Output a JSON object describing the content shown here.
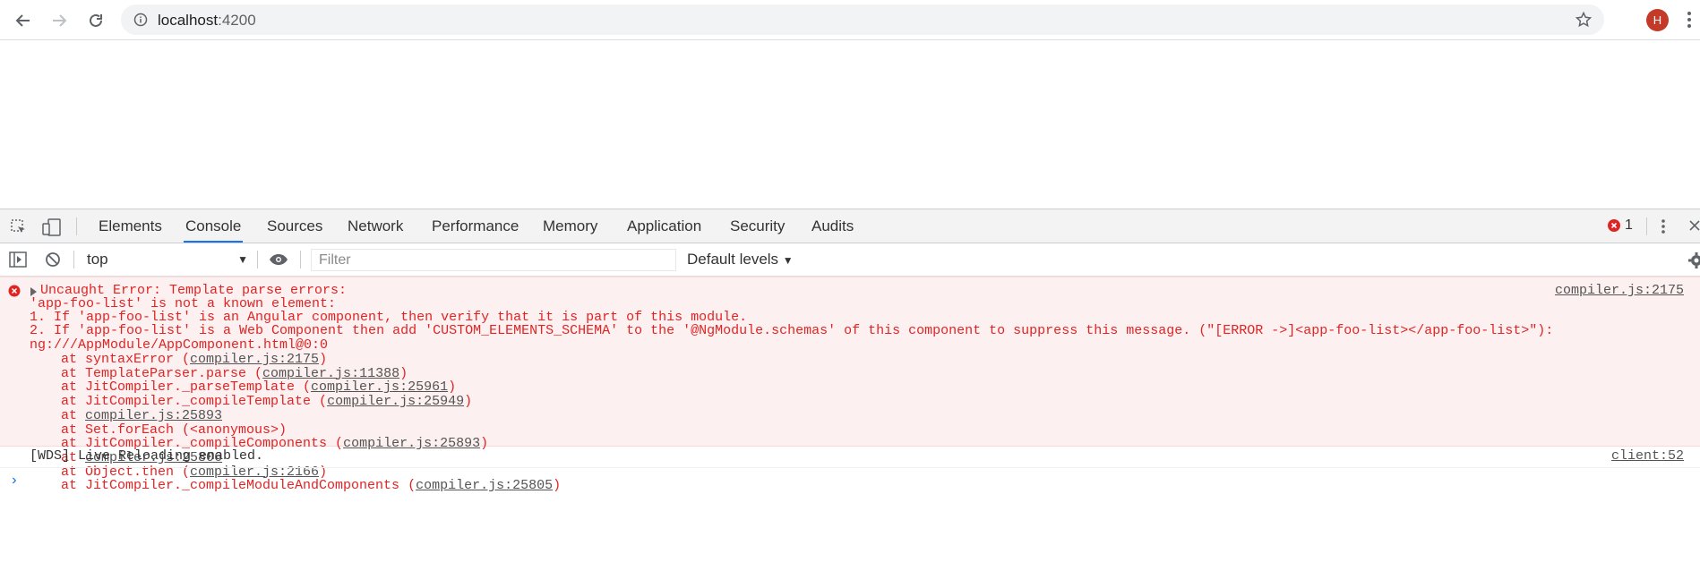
{
  "browser": {
    "url_host": "localhost",
    "url_port": ":4200",
    "avatar_letter": "H"
  },
  "devtools": {
    "tabs": [
      "Elements",
      "Console",
      "Sources",
      "Network",
      "Performance",
      "Memory",
      "Application",
      "Security",
      "Audits"
    ],
    "active_tab": "Console",
    "error_count": "1",
    "context": "top",
    "filter_placeholder": "Filter",
    "levels_label": "Default levels"
  },
  "console": {
    "error": {
      "source": "compiler.js:2175",
      "lines": [
        "Uncaught Error: Template parse errors:",
        "'app-foo-list' is not a known element:",
        "1. If 'app-foo-list' is an Angular component, then verify that it is part of this module.",
        "2. If 'app-foo-list' is a Web Component then add 'CUSTOM_ELEMENTS_SCHEMA' to the '@NgModule.schemas' of this component to suppress this message. (\"[ERROR ->]<app-foo-list></app-foo-list>\"):",
        "ng:///AppModule/AppComponent.html@0:0"
      ],
      "stack": [
        {
          "prefix": "at syntaxError (",
          "link": "compiler.js:2175",
          "suffix": ")"
        },
        {
          "prefix": "at TemplateParser.parse (",
          "link": "compiler.js:11388",
          "suffix": ")"
        },
        {
          "prefix": "at JitCompiler._parseTemplate (",
          "link": "compiler.js:25961",
          "suffix": ")"
        },
        {
          "prefix": "at JitCompiler._compileTemplate (",
          "link": "compiler.js:25949",
          "suffix": ")"
        },
        {
          "prefix": "at ",
          "link": "compiler.js:25893",
          "suffix": ""
        },
        {
          "prefix": "at Set.forEach (<anonymous>)",
          "link": "",
          "suffix": ""
        },
        {
          "prefix": "at JitCompiler._compileComponents (",
          "link": "compiler.js:25893",
          "suffix": ")"
        },
        {
          "prefix": "at ",
          "link": "compiler.js:25806",
          "suffix": ""
        },
        {
          "prefix": "at Object.then (",
          "link": "compiler.js:2166",
          "suffix": ")"
        },
        {
          "prefix": "at JitCompiler._compileModuleAndComponents (",
          "link": "compiler.js:25805",
          "suffix": ")"
        }
      ]
    },
    "log": {
      "text": "[WDS] Live Reloading enabled.",
      "source": "client:52"
    },
    "prompt": "›"
  }
}
